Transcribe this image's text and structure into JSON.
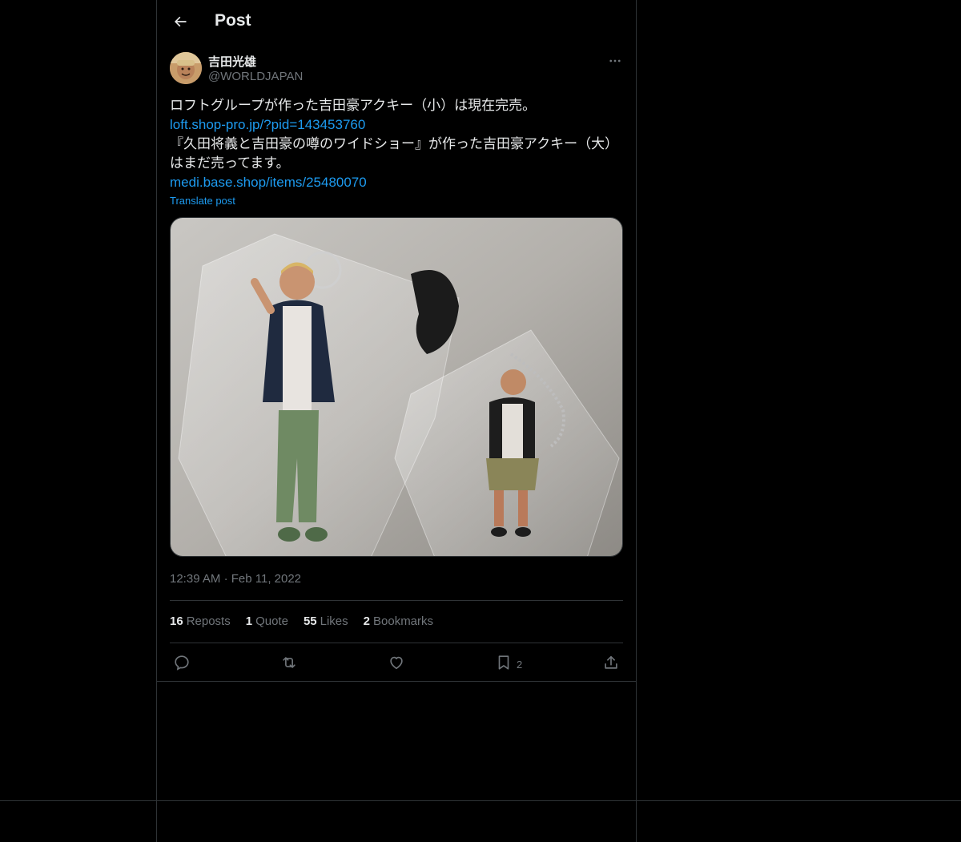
{
  "header": {
    "title": "Post",
    "back_icon": "arrow-left-icon"
  },
  "author": {
    "display_name": "吉田光雄",
    "handle": "@WORLDJAPAN"
  },
  "post": {
    "line1": "ロフトグループが作った吉田豪アクキー（小）は現在完売。",
    "link1": "loft.shop-pro.jp/?pid=143453760",
    "line2": "『久田将義と吉田豪の噂のワイドショー』が作った吉田豪アクキー（大）",
    "line3": "はまだ売ってます。",
    "link2": "medi.base.shop/items/25480070",
    "translate": "Translate post"
  },
  "meta": {
    "time": "12:39 AM",
    "separator": "·",
    "date": "Feb 11, 2022"
  },
  "stats": {
    "reposts_count": "16",
    "reposts_label": "Reposts",
    "quote_count": "1",
    "quote_label": "Quote",
    "likes_count": "55",
    "likes_label": "Likes",
    "bookmarks_count": "2",
    "bookmarks_label": "Bookmarks"
  },
  "actions": {
    "bookmark_count": "2"
  },
  "colors": {
    "background": "#000000",
    "text": "#e7e9ea",
    "muted": "#71767b",
    "link": "#1d9bf0",
    "border": "#2f3336"
  }
}
